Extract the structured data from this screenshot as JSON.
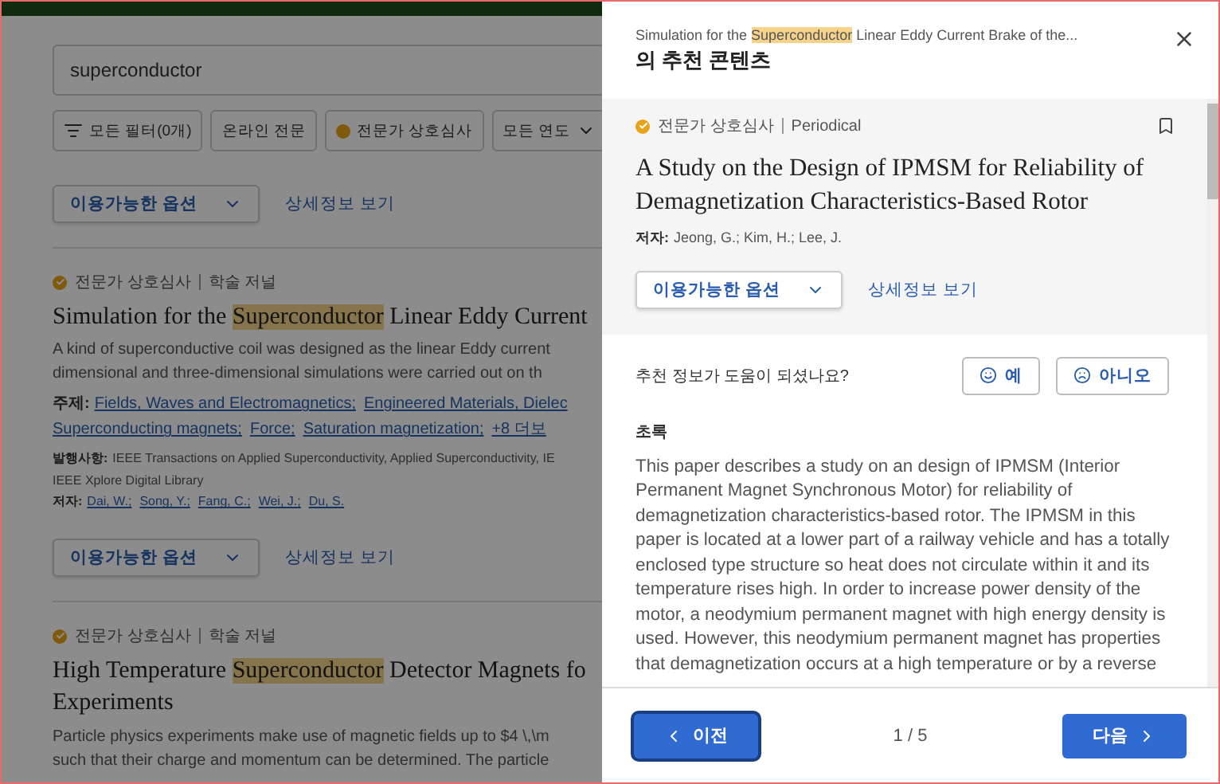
{
  "search": {
    "value": "superconductor"
  },
  "filters": [
    {
      "kind": "filter",
      "label": "모든 필터(0개)"
    },
    {
      "kind": "plain",
      "label": "온라인 전문"
    },
    {
      "kind": "check",
      "label": "전문가 상호심사"
    },
    {
      "kind": "dropdown",
      "label": "모든 연도"
    }
  ],
  "options_row": {
    "dropdown": "이용가능한 옵션",
    "link": "상세정보 보기"
  },
  "results": [
    {
      "badge": "전문가 상호심사",
      "type": "학술 저널",
      "title": {
        "before": "Simulation for the ",
        "highlight": "Superconductor",
        "after": " Linear Eddy Current"
      },
      "abstract": [
        "A kind of superconductive coil was designed as the linear Eddy current",
        "dimensional and three-dimensional simulations were carried out on th"
      ],
      "subjects_label": "주제:",
      "subjects": [
        "Fields, Waves and Electromagnetics;",
        "Engineered Materials, Dielec",
        "Superconducting magnets;",
        "Force;",
        "Saturation magnetization;",
        "+8 더보"
      ],
      "publisher_label": "발행사항:",
      "publisher": [
        "IEEE Transactions on Applied Superconductivity, Applied Superconductivity, IE",
        "IEEE Xplore Digital Library"
      ],
      "authors_label": "저자:",
      "authors": [
        "Dai, W.;",
        "Song, Y.;",
        "Fang, C.;",
        "Wei, J.;",
        "Du, S."
      ],
      "options": {
        "dropdown": "이용가능한 옵션",
        "link": "상세정보 보기"
      }
    },
    {
      "badge": "전문가 상호심사",
      "type": "학술 저널",
      "title": {
        "before": "High Temperature ",
        "highlight": "Superconductor",
        "after": " Detector Magnets fo",
        "continuation": "Experiments"
      },
      "abstract": [
        "Particle physics experiments make use of magnetic fields up to $4 \\,\\m",
        "such that their charge and momentum can be determined. The particle"
      ]
    }
  ],
  "drawer": {
    "context": {
      "before": "Simulation for the ",
      "highlight": "Superconductor",
      "after": " Linear Eddy Current Brake of the..."
    },
    "heading": "의 추천 콘텐츠",
    "card": {
      "badge": "전문가 상호심사",
      "type": "Periodical",
      "title": "A Study on the Design of IPMSM for Reliability of Demagnetization Characteristics-Based Rotor",
      "authors_label": "저자:",
      "authors": "Jeong, G.; Kim, H.; Lee, J.",
      "dropdown": "이용가능한 옵션",
      "link": "상세정보 보기"
    },
    "feedback": {
      "question": "추천 정보가 도움이 되셨나요?",
      "yes": "예",
      "no": "아니오"
    },
    "abstract_heading": "초록",
    "abstract": [
      "This paper describes a study on an design of IPMSM (Interior",
      "Permanent Magnet Synchronous Motor) for reliability of",
      "demagnetization characteristics-based rotor. The IPMSM in this",
      "paper is located at a lower part of a railway vehicle and has a totally",
      "enclosed type structure so heat does not circulate within it and its",
      "temperature rises high. In order to increase power density of the",
      "motor, a neodymium permanent magnet with high energy density is",
      "used. However, this neodymium permanent magnet has properties",
      "that demagnetization occurs at a high temperature or by a reverse"
    ],
    "footer": {
      "prev": "이전",
      "page": "1 / 5",
      "next": "다음"
    }
  }
}
